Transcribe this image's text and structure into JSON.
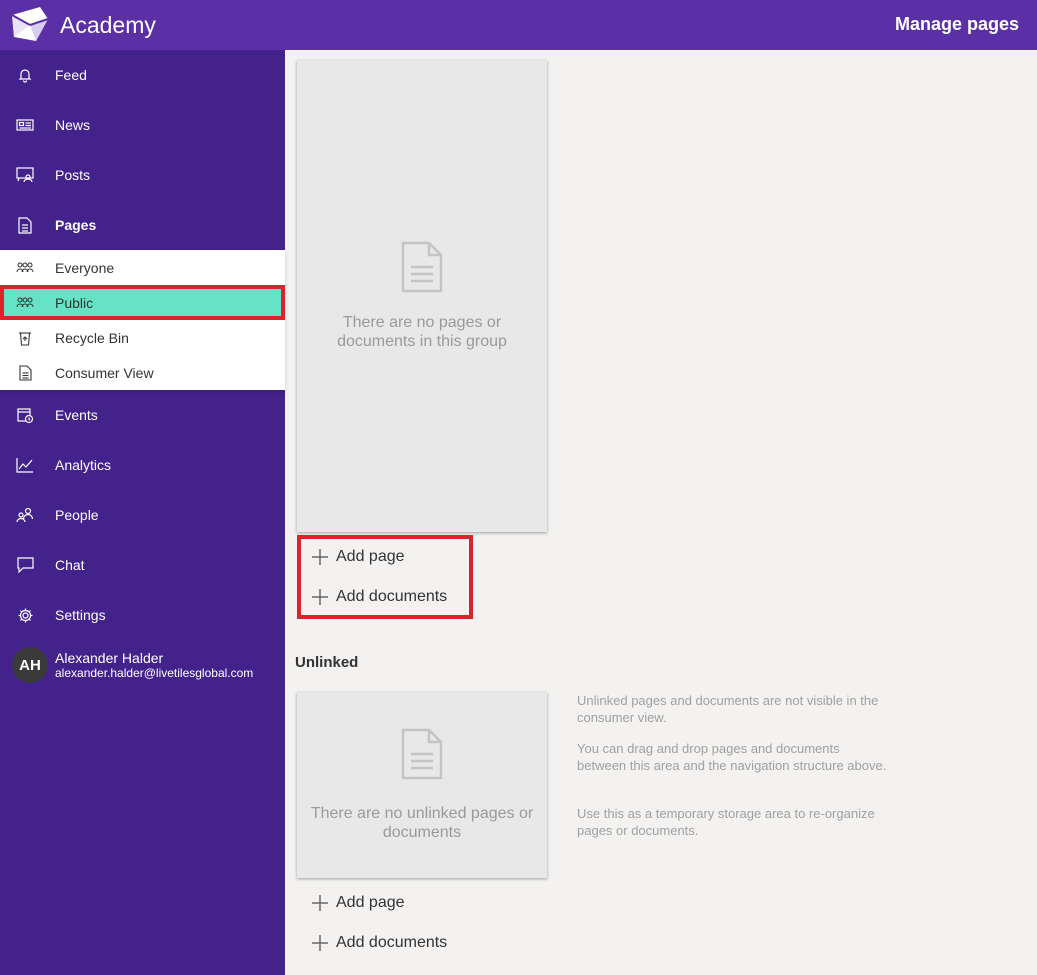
{
  "header": {
    "brand": "Academy",
    "title": "Manage pages"
  },
  "sidebar": {
    "items_top": [
      {
        "label": "Feed",
        "icon": "bell-icon"
      },
      {
        "label": "News",
        "icon": "newspaper-icon"
      },
      {
        "label": "Posts",
        "icon": "posts-icon"
      },
      {
        "label": "Pages",
        "icon": "page-icon"
      }
    ],
    "sub_items": [
      {
        "label": "Everyone",
        "icon": "group-icon"
      },
      {
        "label": "Public",
        "icon": "group-icon"
      },
      {
        "label": "Recycle Bin",
        "icon": "recycle-bin-icon"
      },
      {
        "label": "Consumer View",
        "icon": "document-icon"
      }
    ],
    "items_bottom": [
      {
        "label": "Events",
        "icon": "calendar-icon"
      },
      {
        "label": "Analytics",
        "icon": "chart-icon"
      },
      {
        "label": "People",
        "icon": "people-icon"
      },
      {
        "label": "Chat",
        "icon": "chat-icon"
      },
      {
        "label": "Settings",
        "icon": "gear-icon"
      }
    ],
    "user": {
      "initials": "AH",
      "name": "Alexander Halder",
      "email": "alexander.halder@livetilesglobal.com"
    }
  },
  "main": {
    "group_card": {
      "empty_text": "There are no pages or documents in this group"
    },
    "group_actions": {
      "add_page": "Add page",
      "add_documents": "Add documents"
    },
    "unlinked": {
      "title": "Unlinked",
      "empty_text": "There are no unlinked pages or documents",
      "add_page": "Add page",
      "add_documents": "Add documents",
      "info": [
        "Unlinked pages and documents are not visible in the consumer view.",
        "You can drag and drop pages and documents between this area and the navigation structure above.",
        "Use this as a temporary storage area to re-organize pages or documents."
      ]
    }
  },
  "colors": {
    "topbar": "#5b2fa6",
    "sidebar": "#44228c",
    "active": "#66e3c6",
    "highlight": "#d9242b"
  }
}
